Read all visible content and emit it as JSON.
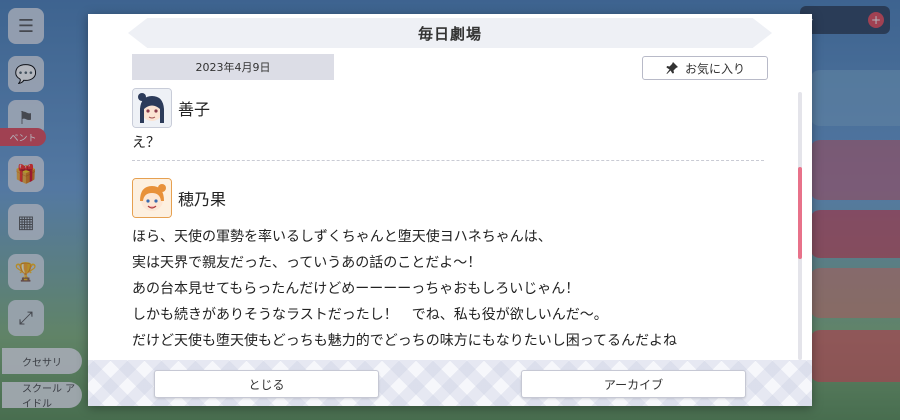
{
  "theater": {
    "title": "毎日劇場",
    "date": "2023年4月9日",
    "favorite_label": "お気に入り",
    "entries": [
      {
        "speaker": "善子",
        "lines": [
          "え？"
        ]
      },
      {
        "speaker": "穂乃果",
        "lines": [
          "ほら、天使の軍勢を率いるしずくちゃんと堕天使ヨハネちゃんは、",
          "実は天界で親友だった、っていうあの話のことだよ～！",
          "あの台本見せてもらったんだけどめーーーーっちゃおもしろいじゃん！",
          "しかも続きがありそうなラストだったし！　でね、私も役が欲しいんだ～。",
          "だけど天使も堕天使もどっちも魅力的でどっちの味方にもなりたいし困ってるんだよね"
        ]
      }
    ],
    "close_label": "とじる",
    "archive_label": "アーカイブ"
  },
  "background": {
    "event_label": "ベント",
    "menu_labels": [
      "クセサリ",
      "スクール アイドル"
    ]
  },
  "icons": {
    "favorite": "pin-icon",
    "menu": "hamburger-icon"
  },
  "colors": {
    "scroll_thumb": "#e8728a",
    "event_tag": "#e04a5a"
  }
}
